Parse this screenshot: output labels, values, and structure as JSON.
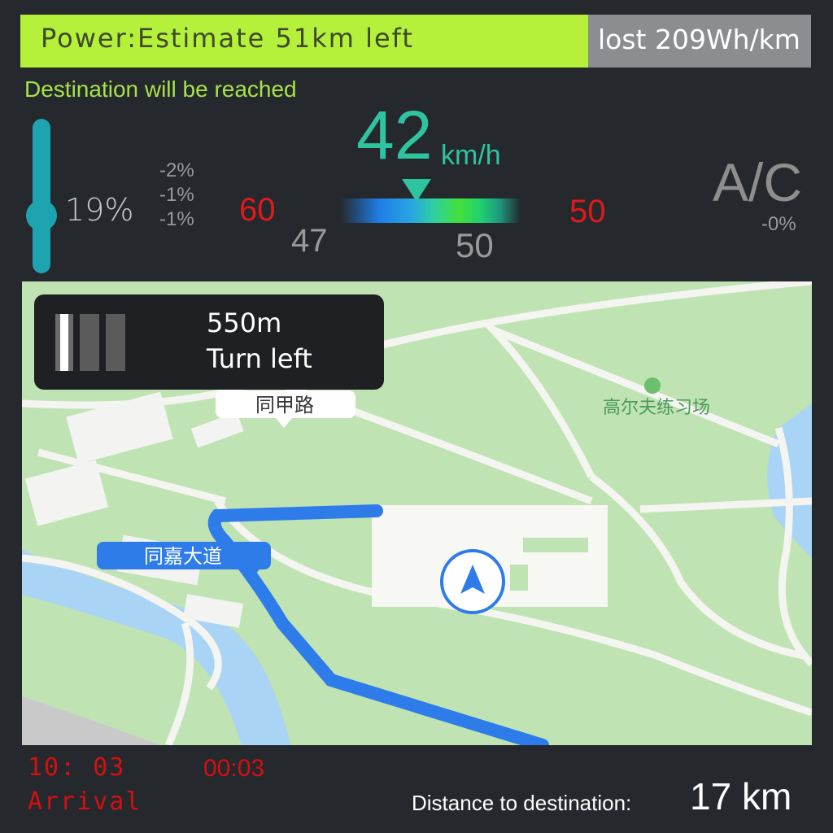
{
  "header": {
    "power_text": "Power:Estimate 51km left",
    "lost_text": "lost 209Wh/km",
    "destination_message": "Destination will  be reached"
  },
  "battery": {
    "percent_label": "19%",
    "slider_level_pct": 50,
    "consumption": [
      "-2%",
      "-1%",
      "-1%"
    ]
  },
  "speed": {
    "value": "42",
    "unit": "km/h",
    "left_limit": "60",
    "right_limit": "50",
    "scale_left": "47",
    "scale_right": "50"
  },
  "climate": {
    "label": "A/C",
    "percent": "-0%"
  },
  "navigation": {
    "next_distance": "550m",
    "instruction": "Turn left",
    "street_top": "同甲路",
    "street_left": "同嘉大道",
    "poi": "高尔夫练习场"
  },
  "footer": {
    "clock": "10: 03",
    "arrival_label": "Arrival",
    "elapsed": "00:03",
    "distance_label": "Distance to destination:",
    "distance_value": "17 km"
  },
  "colors": {
    "accent_green": "#b5f03a",
    "speed_teal": "#2ec4a0",
    "warning_red": "#e01a1a",
    "route_blue": "#2e7bea"
  }
}
